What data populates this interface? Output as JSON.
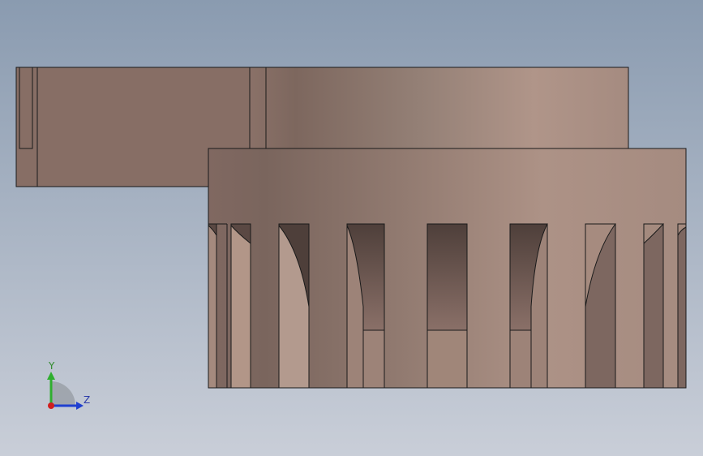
{
  "colors": {
    "background_top": "#8a9bb0",
    "background_bottom": "#c9ced8",
    "part_light": "#b3968a",
    "part_mid": "#8f766b",
    "part_dark": "#6f5a52",
    "edge": "#1a1a1a",
    "axis_y": "#2fae2f",
    "axis_z": "#1f3fd0",
    "axis_x": "#d01f1f"
  },
  "triad": {
    "y_label": "Y",
    "z_label": "Z",
    "icon": "coordinate-triad-icon"
  },
  "view": {
    "name": "side-view",
    "parts": [
      "upper-body",
      "lower-slotted-body"
    ]
  }
}
